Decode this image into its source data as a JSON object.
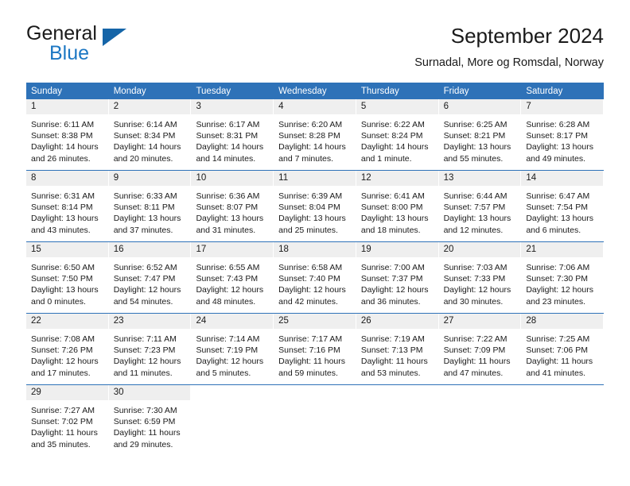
{
  "logo": {
    "word_dark": "General",
    "word_blue": "Blue",
    "icon": "triangle-logo-icon",
    "blue": "#1c77c3",
    "triangle_blue": "#1565a8"
  },
  "header": {
    "title": "September 2024",
    "subtitle": "Surnadal, More og Romsdal, Norway"
  },
  "theme": {
    "header_blue": "#2e72b8",
    "day_band_gray": "#efefef",
    "text": "#1a1a1a"
  },
  "weekdays": [
    "Sunday",
    "Monday",
    "Tuesday",
    "Wednesday",
    "Thursday",
    "Friday",
    "Saturday"
  ],
  "weeks": [
    [
      {
        "day": "1",
        "sunrise": "Sunrise: 6:11 AM",
        "sunset": "Sunset: 8:38 PM",
        "daylight1": "Daylight: 14 hours",
        "daylight2": "and 26 minutes."
      },
      {
        "day": "2",
        "sunrise": "Sunrise: 6:14 AM",
        "sunset": "Sunset: 8:34 PM",
        "daylight1": "Daylight: 14 hours",
        "daylight2": "and 20 minutes."
      },
      {
        "day": "3",
        "sunrise": "Sunrise: 6:17 AM",
        "sunset": "Sunset: 8:31 PM",
        "daylight1": "Daylight: 14 hours",
        "daylight2": "and 14 minutes."
      },
      {
        "day": "4",
        "sunrise": "Sunrise: 6:20 AM",
        "sunset": "Sunset: 8:28 PM",
        "daylight1": "Daylight: 14 hours",
        "daylight2": "and 7 minutes."
      },
      {
        "day": "5",
        "sunrise": "Sunrise: 6:22 AM",
        "sunset": "Sunset: 8:24 PM",
        "daylight1": "Daylight: 14 hours",
        "daylight2": "and 1 minute."
      },
      {
        "day": "6",
        "sunrise": "Sunrise: 6:25 AM",
        "sunset": "Sunset: 8:21 PM",
        "daylight1": "Daylight: 13 hours",
        "daylight2": "and 55 minutes."
      },
      {
        "day": "7",
        "sunrise": "Sunrise: 6:28 AM",
        "sunset": "Sunset: 8:17 PM",
        "daylight1": "Daylight: 13 hours",
        "daylight2": "and 49 minutes."
      }
    ],
    [
      {
        "day": "8",
        "sunrise": "Sunrise: 6:31 AM",
        "sunset": "Sunset: 8:14 PM",
        "daylight1": "Daylight: 13 hours",
        "daylight2": "and 43 minutes."
      },
      {
        "day": "9",
        "sunrise": "Sunrise: 6:33 AM",
        "sunset": "Sunset: 8:11 PM",
        "daylight1": "Daylight: 13 hours",
        "daylight2": "and 37 minutes."
      },
      {
        "day": "10",
        "sunrise": "Sunrise: 6:36 AM",
        "sunset": "Sunset: 8:07 PM",
        "daylight1": "Daylight: 13 hours",
        "daylight2": "and 31 minutes."
      },
      {
        "day": "11",
        "sunrise": "Sunrise: 6:39 AM",
        "sunset": "Sunset: 8:04 PM",
        "daylight1": "Daylight: 13 hours",
        "daylight2": "and 25 minutes."
      },
      {
        "day": "12",
        "sunrise": "Sunrise: 6:41 AM",
        "sunset": "Sunset: 8:00 PM",
        "daylight1": "Daylight: 13 hours",
        "daylight2": "and 18 minutes."
      },
      {
        "day": "13",
        "sunrise": "Sunrise: 6:44 AM",
        "sunset": "Sunset: 7:57 PM",
        "daylight1": "Daylight: 13 hours",
        "daylight2": "and 12 minutes."
      },
      {
        "day": "14",
        "sunrise": "Sunrise: 6:47 AM",
        "sunset": "Sunset: 7:54 PM",
        "daylight1": "Daylight: 13 hours",
        "daylight2": "and 6 minutes."
      }
    ],
    [
      {
        "day": "15",
        "sunrise": "Sunrise: 6:50 AM",
        "sunset": "Sunset: 7:50 PM",
        "daylight1": "Daylight: 13 hours",
        "daylight2": "and 0 minutes."
      },
      {
        "day": "16",
        "sunrise": "Sunrise: 6:52 AM",
        "sunset": "Sunset: 7:47 PM",
        "daylight1": "Daylight: 12 hours",
        "daylight2": "and 54 minutes."
      },
      {
        "day": "17",
        "sunrise": "Sunrise: 6:55 AM",
        "sunset": "Sunset: 7:43 PM",
        "daylight1": "Daylight: 12 hours",
        "daylight2": "and 48 minutes."
      },
      {
        "day": "18",
        "sunrise": "Sunrise: 6:58 AM",
        "sunset": "Sunset: 7:40 PM",
        "daylight1": "Daylight: 12 hours",
        "daylight2": "and 42 minutes."
      },
      {
        "day": "19",
        "sunrise": "Sunrise: 7:00 AM",
        "sunset": "Sunset: 7:37 PM",
        "daylight1": "Daylight: 12 hours",
        "daylight2": "and 36 minutes."
      },
      {
        "day": "20",
        "sunrise": "Sunrise: 7:03 AM",
        "sunset": "Sunset: 7:33 PM",
        "daylight1": "Daylight: 12 hours",
        "daylight2": "and 30 minutes."
      },
      {
        "day": "21",
        "sunrise": "Sunrise: 7:06 AM",
        "sunset": "Sunset: 7:30 PM",
        "daylight1": "Daylight: 12 hours",
        "daylight2": "and 23 minutes."
      }
    ],
    [
      {
        "day": "22",
        "sunrise": "Sunrise: 7:08 AM",
        "sunset": "Sunset: 7:26 PM",
        "daylight1": "Daylight: 12 hours",
        "daylight2": "and 17 minutes."
      },
      {
        "day": "23",
        "sunrise": "Sunrise: 7:11 AM",
        "sunset": "Sunset: 7:23 PM",
        "daylight1": "Daylight: 12 hours",
        "daylight2": "and 11 minutes."
      },
      {
        "day": "24",
        "sunrise": "Sunrise: 7:14 AM",
        "sunset": "Sunset: 7:19 PM",
        "daylight1": "Daylight: 12 hours",
        "daylight2": "and 5 minutes."
      },
      {
        "day": "25",
        "sunrise": "Sunrise: 7:17 AM",
        "sunset": "Sunset: 7:16 PM",
        "daylight1": "Daylight: 11 hours",
        "daylight2": "and 59 minutes."
      },
      {
        "day": "26",
        "sunrise": "Sunrise: 7:19 AM",
        "sunset": "Sunset: 7:13 PM",
        "daylight1": "Daylight: 11 hours",
        "daylight2": "and 53 minutes."
      },
      {
        "day": "27",
        "sunrise": "Sunrise: 7:22 AM",
        "sunset": "Sunset: 7:09 PM",
        "daylight1": "Daylight: 11 hours",
        "daylight2": "and 47 minutes."
      },
      {
        "day": "28",
        "sunrise": "Sunrise: 7:25 AM",
        "sunset": "Sunset: 7:06 PM",
        "daylight1": "Daylight: 11 hours",
        "daylight2": "and 41 minutes."
      }
    ],
    [
      {
        "day": "29",
        "sunrise": "Sunrise: 7:27 AM",
        "sunset": "Sunset: 7:02 PM",
        "daylight1": "Daylight: 11 hours",
        "daylight2": "and 35 minutes."
      },
      {
        "day": "30",
        "sunrise": "Sunrise: 7:30 AM",
        "sunset": "Sunset: 6:59 PM",
        "daylight1": "Daylight: 11 hours",
        "daylight2": "and 29 minutes."
      },
      {
        "day": "",
        "sunrise": "",
        "sunset": "",
        "daylight1": "",
        "daylight2": ""
      },
      {
        "day": "",
        "sunrise": "",
        "sunset": "",
        "daylight1": "",
        "daylight2": ""
      },
      {
        "day": "",
        "sunrise": "",
        "sunset": "",
        "daylight1": "",
        "daylight2": ""
      },
      {
        "day": "",
        "sunrise": "",
        "sunset": "",
        "daylight1": "",
        "daylight2": ""
      },
      {
        "day": "",
        "sunrise": "",
        "sunset": "",
        "daylight1": "",
        "daylight2": ""
      }
    ]
  ]
}
